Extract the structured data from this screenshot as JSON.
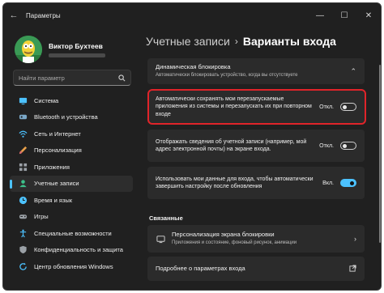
{
  "window": {
    "title": "Параметры"
  },
  "profile": {
    "name": "Виктор Бухтеев"
  },
  "search": {
    "placeholder": "Найти параметр"
  },
  "sidebar": {
    "items": [
      {
        "label": "Система",
        "icon": "system-icon",
        "active": false
      },
      {
        "label": "Bluetooth и устройства",
        "icon": "bluetooth-icon",
        "active": false
      },
      {
        "label": "Сеть и Интернет",
        "icon": "network-icon",
        "active": false
      },
      {
        "label": "Персонализация",
        "icon": "brush-icon",
        "active": false
      },
      {
        "label": "Приложения",
        "icon": "apps-icon",
        "active": false
      },
      {
        "label": "Учетные записи",
        "icon": "accounts-icon",
        "active": true
      },
      {
        "label": "Время и язык",
        "icon": "clock-icon",
        "active": false
      },
      {
        "label": "Игры",
        "icon": "gaming-icon",
        "active": false
      },
      {
        "label": "Специальные возможности",
        "icon": "accessibility-icon",
        "active": false
      },
      {
        "label": "Конфиденциальность и защита",
        "icon": "shield-icon",
        "active": false
      },
      {
        "label": "Центр обновления Windows",
        "icon": "update-icon",
        "active": false
      }
    ]
  },
  "breadcrumb": {
    "parent": "Учетные записи",
    "separator": "›",
    "current": "Варианты входа"
  },
  "cards": {
    "dynamic_lock": {
      "title": "Динамическая блокировка",
      "desc": "Автоматически блокировать устройство, когда вы отсутствуете"
    },
    "restart_apps": {
      "text": "Автоматически сохранять мои перезапускаемые приложения из системы и перезапускать их при повторном входе",
      "state_label": "Откл.",
      "on": false
    },
    "show_account": {
      "text": "Отображать сведения об учетной записи (например, мой адрес электронной почты) на экране входа.",
      "state_label": "Откл.",
      "on": false
    },
    "use_signin": {
      "text": "Использовать мои данные для входа, чтобы автоматически завершить настройку после обновления",
      "state_label": "Вкл.",
      "on": true
    },
    "lock_screen": {
      "title": "Персонализация экрана блокировки",
      "desc": "Приложения и состояние, фоновый рисунок, анимации"
    },
    "more_info": {
      "title": "Подробнее о параметрах входа"
    }
  },
  "related": {
    "title": "Связанные"
  },
  "colors": {
    "accent": "#4cc2ff",
    "highlight_border": "#e0242a",
    "window_bg": "#202020",
    "card_bg": "#2b2b2b"
  }
}
